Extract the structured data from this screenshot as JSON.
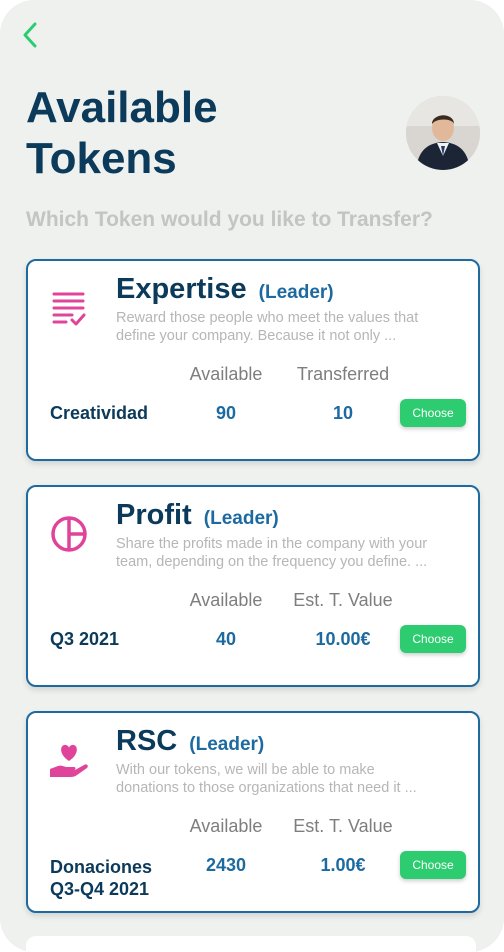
{
  "header": {
    "title_line1": "Available",
    "title_line2": "Tokens"
  },
  "prompt": "Which Token would you like to Transfer?",
  "colors": {
    "title": "#0b3a5a",
    "accent": "#1d6aa0",
    "icon": "#e0449a",
    "button": "#2ecc71"
  },
  "cards": [
    {
      "icon": "checklist-icon",
      "name": "Expertise",
      "role": "(Leader)",
      "desc_line1": "Reward those people who meet the values that",
      "desc_line2": "define your company. Because it not only ...",
      "col1": "Available",
      "col2": "Transferred",
      "label_line1": "Creatividad",
      "label_line2": "",
      "value1": "90",
      "value2": "10",
      "button": "Choose"
    },
    {
      "icon": "pie-chart-icon",
      "name": "Profit",
      "role": "(Leader)",
      "desc_line1": "Share the profits made in the company with your",
      "desc_line2": "team, depending on the frequency you define. ...",
      "col1": "Available",
      "col2": "Est. T. Value",
      "label_line1": "Q3 2021",
      "label_line2": "",
      "value1": "40",
      "value2": "10.00€",
      "button": "Choose"
    },
    {
      "icon": "heart-hand-icon",
      "name": "RSC",
      "role": "(Leader)",
      "desc_line1": "With our tokens, we will be able to make",
      "desc_line2": "donations to those organizations that need it ...",
      "col1": "Available",
      "col2": "Est. T. Value",
      "label_line1": "Donaciones",
      "label_line2": "Q3-Q4 2021",
      "value1": "2430",
      "value2": "1.00€",
      "button": "Choose"
    }
  ]
}
